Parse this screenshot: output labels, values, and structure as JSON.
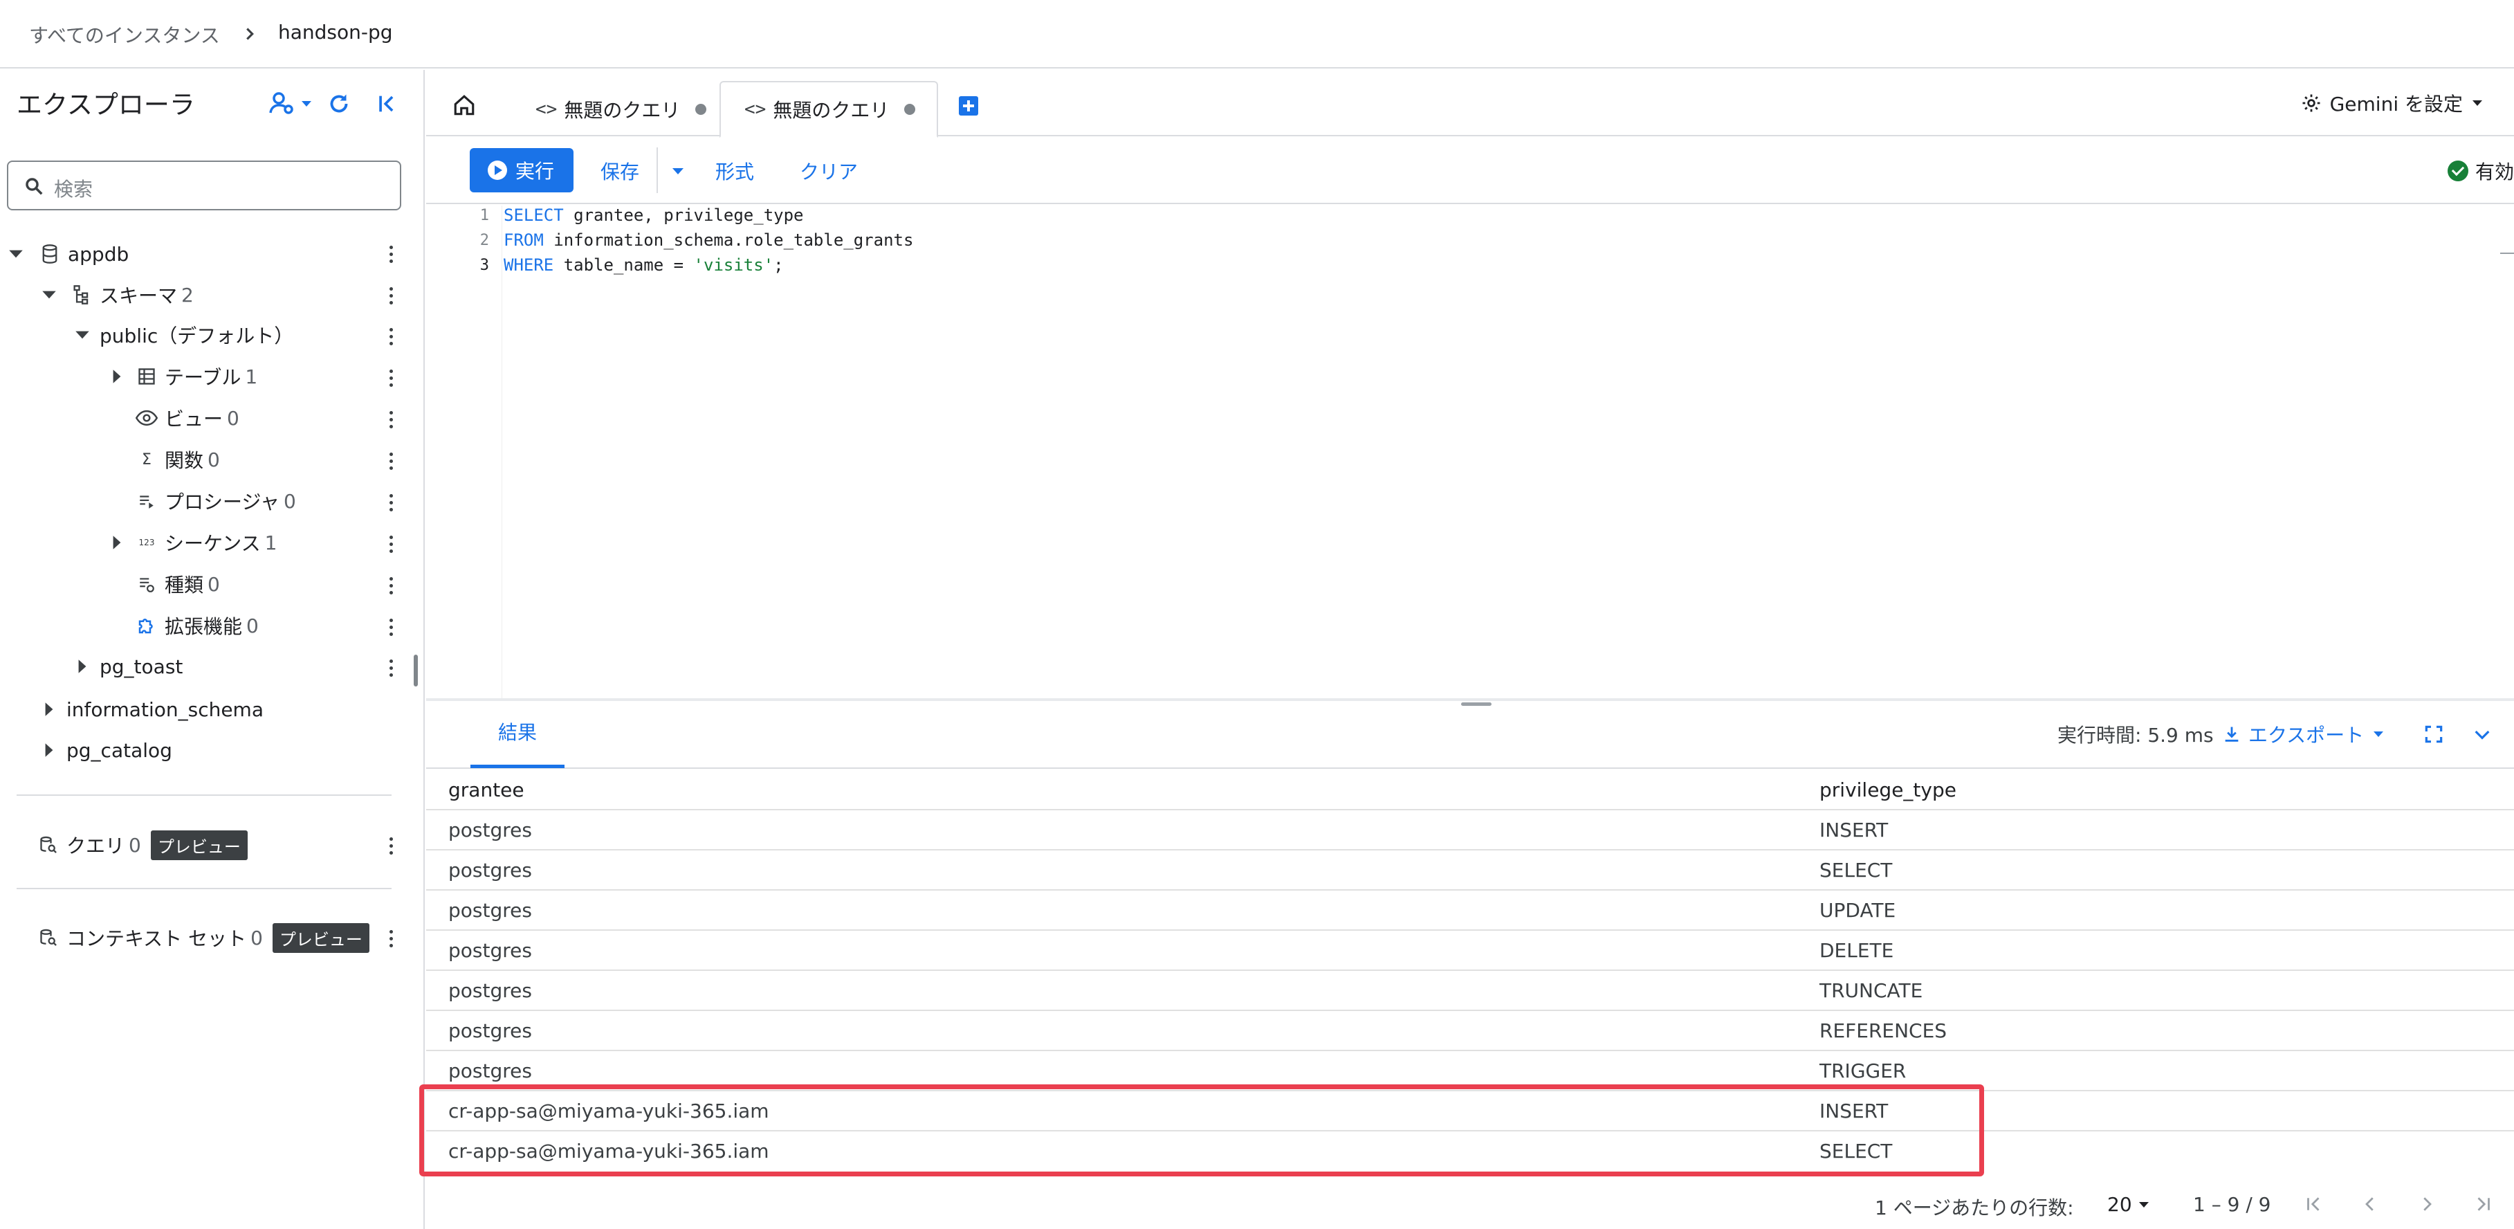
{
  "breadcrumb": {
    "all": "すべてのインスタンス",
    "current": "handson-pg"
  },
  "explorer": {
    "title": "エクスプローラ",
    "search_placeholder": "検索",
    "tree": {
      "db": "appdb",
      "schemas": {
        "label": "スキーマ",
        "count": "2"
      },
      "public": "public（デフォルト）",
      "tables": {
        "label": "テーブル",
        "count": "1"
      },
      "views": {
        "label": "ビュー",
        "count": "0"
      },
      "functions": {
        "label": "関数",
        "count": "0"
      },
      "procedures": {
        "label": "プロシージャ",
        "count": "0"
      },
      "sequences": {
        "label": "シーケンス",
        "count": "1"
      },
      "types": {
        "label": "種類",
        "count": "0"
      },
      "extensions": {
        "label": "拡張機能",
        "count": "0"
      },
      "pg_toast": "pg_toast",
      "information_schema": "information_schema",
      "pg_catalog": "pg_catalog"
    },
    "queries": {
      "label": "クエリ",
      "count": "0",
      "badge": "プレビュー"
    },
    "context_sets": {
      "label": "コンテキスト セット",
      "count": "0",
      "badge": "プレビュー"
    }
  },
  "tabs": [
    {
      "label": "無題のクエリ",
      "code": "<>"
    },
    {
      "label": "無題のクエリ",
      "code": "<>"
    }
  ],
  "gemini": "Gemini を設定",
  "toolbar": {
    "run": "実行",
    "save": "保存",
    "format": "形式",
    "clear": "クリア",
    "status": "有効"
  },
  "editor": {
    "lines": [
      {
        "num": "1",
        "kw": "SELECT",
        "rest": " grantee, privilege_type",
        "str": "",
        "end": ""
      },
      {
        "num": "2",
        "kw": "FROM",
        "rest": " information_schema.role_table_grants",
        "str": "",
        "end": ""
      },
      {
        "num": "3",
        "kw": "WHERE",
        "rest": " table_name = ",
        "str": "'visits'",
        "end": ";"
      }
    ]
  },
  "results": {
    "tab": "結果",
    "exec_time": "実行時間: 5.9 ms",
    "export": "エクスポート",
    "columns": [
      "grantee",
      "privilege_type"
    ],
    "rows": [
      [
        "postgres",
        "INSERT"
      ],
      [
        "postgres",
        "SELECT"
      ],
      [
        "postgres",
        "UPDATE"
      ],
      [
        "postgres",
        "DELETE"
      ],
      [
        "postgres",
        "TRUNCATE"
      ],
      [
        "postgres",
        "REFERENCES"
      ],
      [
        "postgres",
        "TRIGGER"
      ],
      [
        "cr-app-sa@miyama-yuki-365.iam",
        "INSERT"
      ],
      [
        "cr-app-sa@miyama-yuki-365.iam",
        "SELECT"
      ]
    ],
    "pager": {
      "rows_per_page_label": "1 ページあたりの行数:",
      "page_size": "20",
      "range": "1 – 9 / 9"
    }
  },
  "colors": {
    "accent": "#1a73e8",
    "highlight": "#ea3f4f",
    "ok": "#188038"
  }
}
